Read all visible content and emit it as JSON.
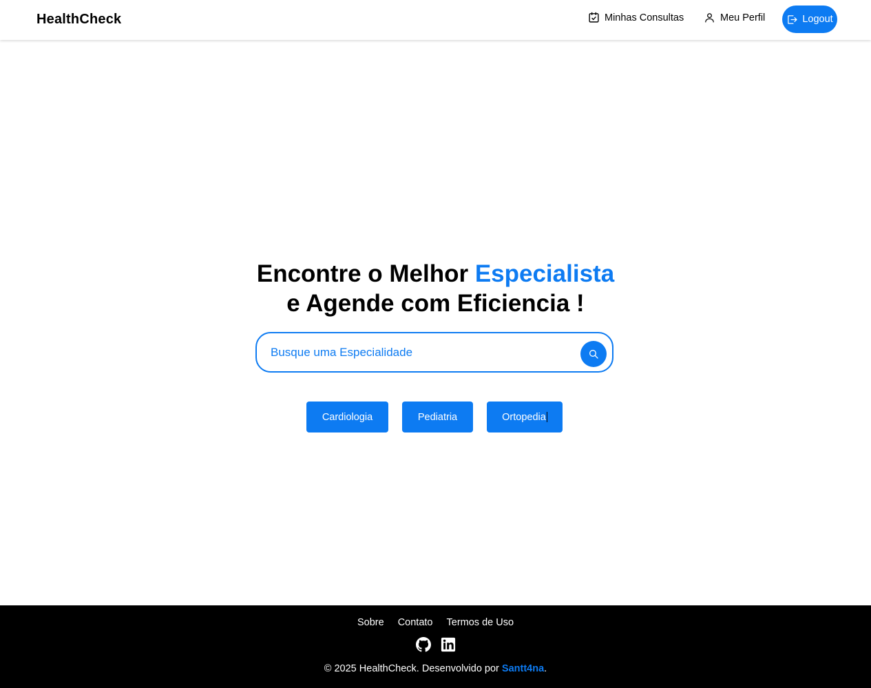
{
  "header": {
    "brand": "HealthCheck",
    "nav": {
      "consultas_label": "Minhas Consultas",
      "perfil_label": "Meu Perfil",
      "logout_label": "Logout"
    },
    "icons": {
      "consultas": "calendar-check-icon",
      "perfil": "user-icon",
      "logout": "logout-icon"
    }
  },
  "hero": {
    "title_part1": "Encontre o Melhor ",
    "title_accent": "Especialista",
    "title_line2": "e Agende com Eficiencia !",
    "search": {
      "placeholder": "Busque uma Especialidade",
      "icon": "search-icon"
    },
    "chips": [
      "Cardiologia",
      "Pediatria",
      "Ortopedia"
    ]
  },
  "footer": {
    "links": [
      "Sobre",
      "Contato",
      "Termos de Uso"
    ],
    "social": [
      "github-icon",
      "linkedin-icon"
    ],
    "copyright_prefix": "© 2025 HealthCheck. Desenvolvido por ",
    "author": "Santt4na",
    "copyright_suffix": "."
  },
  "colors": {
    "accent": "#0d7bf2",
    "footer_bg": "#000000",
    "text": "#000000"
  }
}
